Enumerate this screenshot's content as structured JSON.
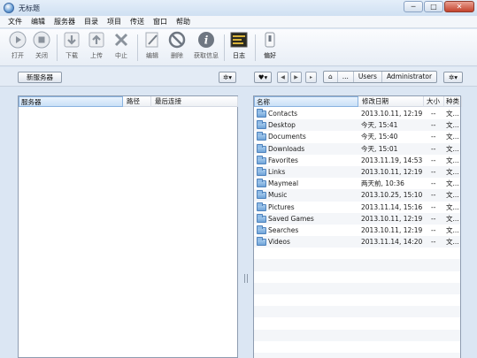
{
  "window": {
    "title": "无标题",
    "minimize": "─",
    "maximize": "□",
    "close": "✕"
  },
  "menu": [
    "文件",
    "编辑",
    "服务器",
    "目录",
    "项目",
    "传送",
    "窗口",
    "帮助"
  ],
  "toolbar": {
    "open": "打开",
    "close": "关闭",
    "download": "下载",
    "upload": "上传",
    "stop": "中止",
    "edit": "编辑",
    "delete": "删除",
    "info": "获取信息",
    "log": "日志",
    "prefs": "偏好"
  },
  "subbar": {
    "new_server": "新服务器",
    "gear_left": "✲▾",
    "heart": "♥▾",
    "gear_right": "✲▾",
    "breadcrumbs": [
      "⌂",
      "...",
      "Users",
      "Administrator"
    ]
  },
  "server_panel": {
    "columns": [
      "服务器",
      "路径",
      "最后连接"
    ]
  },
  "file_panel": {
    "columns": [
      "名称",
      "修改日期",
      "大小",
      "种类"
    ],
    "files": [
      {
        "name": "Contacts",
        "date": "2013.10.11, 12:19",
        "size": "--",
        "kind": "文..."
      },
      {
        "name": "Desktop",
        "date": "今天, 15:41",
        "size": "--",
        "kind": "文..."
      },
      {
        "name": "Documents",
        "date": "今天, 15:40",
        "size": "--",
        "kind": "文..."
      },
      {
        "name": "Downloads",
        "date": "今天, 15:01",
        "size": "--",
        "kind": "文..."
      },
      {
        "name": "Favorites",
        "date": "2013.11.19, 14:53",
        "size": "--",
        "kind": "文..."
      },
      {
        "name": "Links",
        "date": "2013.10.11, 12:19",
        "size": "--",
        "kind": "文..."
      },
      {
        "name": "Maymeal",
        "date": "两天前, 10:36",
        "size": "--",
        "kind": "文..."
      },
      {
        "name": "Music",
        "date": "2013.10.25, 15:10",
        "size": "--",
        "kind": "文..."
      },
      {
        "name": "Pictures",
        "date": "2013.11.14, 15:16",
        "size": "--",
        "kind": "文..."
      },
      {
        "name": "Saved Games",
        "date": "2013.10.11, 12:19",
        "size": "--",
        "kind": "文..."
      },
      {
        "name": "Searches",
        "date": "2013.10.11, 12:19",
        "size": "--",
        "kind": "文..."
      },
      {
        "name": "Videos",
        "date": "2013.11.14, 14:20",
        "size": "--",
        "kind": "文..."
      }
    ]
  }
}
